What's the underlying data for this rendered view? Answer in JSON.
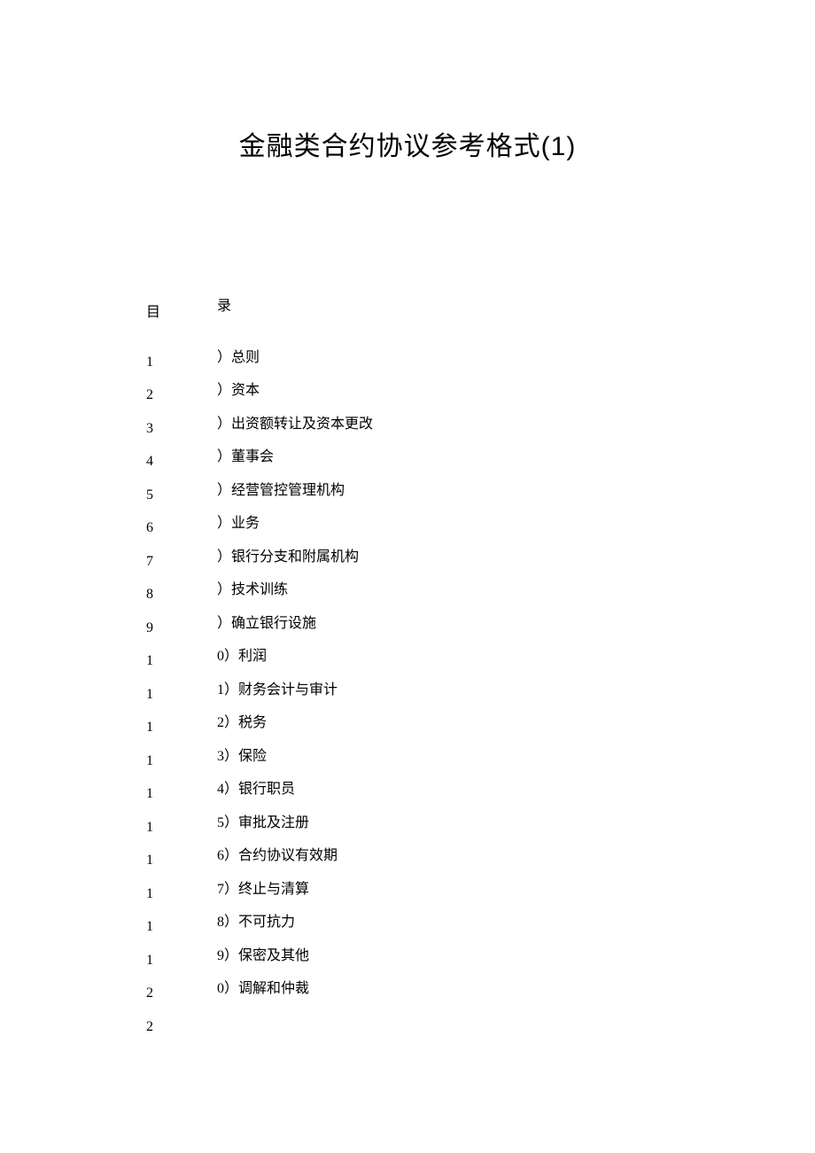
{
  "title": "金融类合约协议参考格式(1)",
  "toc": {
    "header_left": "目",
    "header_right": "录",
    "items": [
      {
        "left": "1",
        "right": "）总则"
      },
      {
        "left": "2",
        "right": "）资本"
      },
      {
        "left": "3",
        "right": "）出资额转让及资本更改"
      },
      {
        "left": "4",
        "right": "）董事会"
      },
      {
        "left": "5",
        "right": "）经营管控管理机构"
      },
      {
        "left": "6",
        "right": "）业务"
      },
      {
        "left": "7",
        "right": "）银行分支和附属机构"
      },
      {
        "left": "8",
        "right": "）技术训练"
      },
      {
        "left": "9",
        "right": "）确立银行设施"
      },
      {
        "left": "1",
        "right": "0）利润"
      },
      {
        "left": "1",
        "right": "1）财务会计与审计"
      },
      {
        "left": "1",
        "right": "2）税务"
      },
      {
        "left": "1",
        "right": "3）保险"
      },
      {
        "left": "1",
        "right": "4）银行职员"
      },
      {
        "left": "1",
        "right": "5）审批及注册"
      },
      {
        "left": "1",
        "right": "6）合约协议有效期"
      },
      {
        "left": "1",
        "right": "7）终止与清算"
      },
      {
        "left": "1",
        "right": "8）不可抗力"
      },
      {
        "left": "1",
        "right": "9）保密及其他"
      },
      {
        "left": "2",
        "right": "0）调解和仲裁"
      },
      {
        "left": "2",
        "right": ""
      }
    ]
  }
}
